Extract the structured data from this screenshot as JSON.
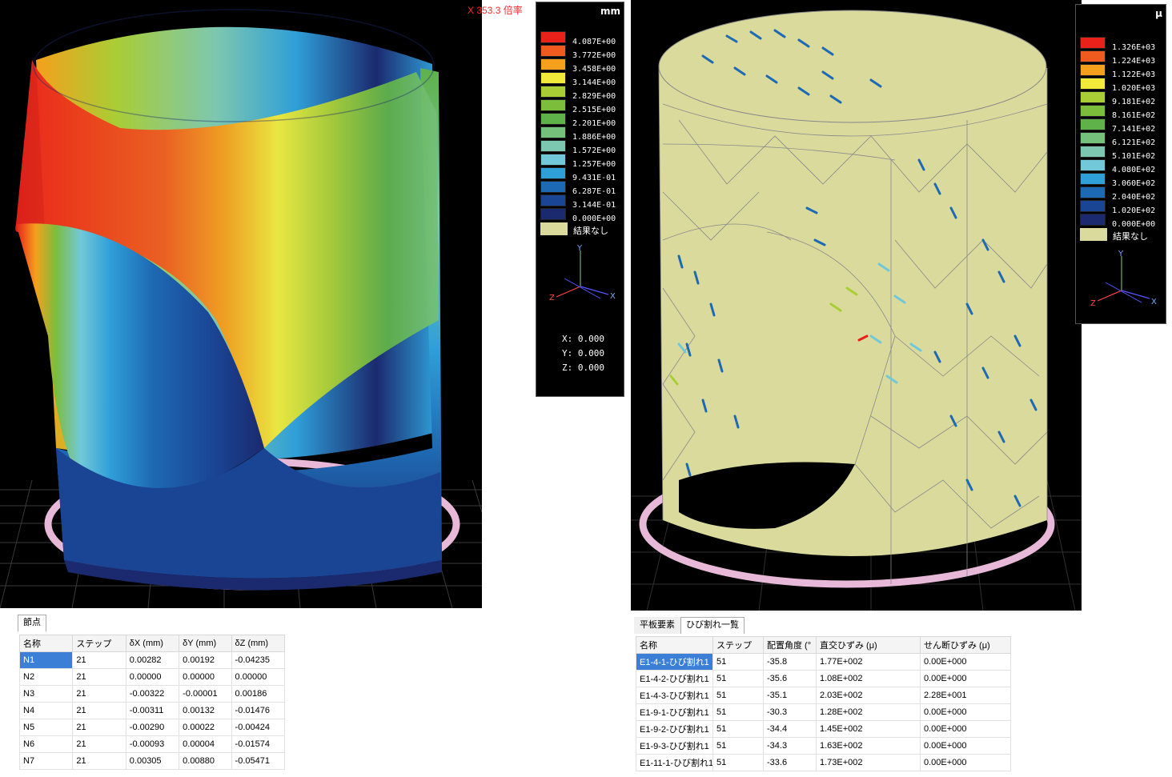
{
  "left_view": {
    "magnification_text": "X 353.3 倍率",
    "legend": {
      "unit": "mm",
      "levels": [
        {
          "value": "4.087E+00",
          "color": "#e8211b"
        },
        {
          "value": "3.772E+00",
          "color": "#ef5a1f"
        },
        {
          "value": "3.458E+00",
          "color": "#f5a01c"
        },
        {
          "value": "3.144E+00",
          "color": "#f2ea3a"
        },
        {
          "value": "2.829E+00",
          "color": "#a9cd35"
        },
        {
          "value": "2.515E+00",
          "color": "#7cbd3c"
        },
        {
          "value": "2.201E+00",
          "color": "#5fb14a"
        },
        {
          "value": "1.886E+00",
          "color": "#75c07a"
        },
        {
          "value": "1.572E+00",
          "color": "#7dc7b0"
        },
        {
          "value": "1.257E+00",
          "color": "#72c8d8"
        },
        {
          "value": "9.431E-01",
          "color": "#2f9fd8"
        },
        {
          "value": "6.287E-01",
          "color": "#1e69b3"
        },
        {
          "value": "3.144E-01",
          "color": "#1a4494"
        },
        {
          "value": "0.000E+00",
          "color": "#1b2a6e"
        }
      ],
      "no_result_label": "結果なし",
      "coords": {
        "x": "X: 0.000",
        "y": "Y: 0.000",
        "z": "Z: 0.000"
      }
    },
    "axis": {
      "x": "X",
      "y": "Y",
      "z": "Z"
    }
  },
  "right_view": {
    "legend": {
      "unit": "μ",
      "levels": [
        {
          "value": "1.326E+03",
          "color": "#e8211b"
        },
        {
          "value": "1.224E+03",
          "color": "#ef5a1f"
        },
        {
          "value": "1.122E+03",
          "color": "#f5a01c"
        },
        {
          "value": "1.020E+03",
          "color": "#f2ea3a"
        },
        {
          "value": "9.181E+02",
          "color": "#a9cd35"
        },
        {
          "value": "8.161E+02",
          "color": "#7cbd3c"
        },
        {
          "value": "7.141E+02",
          "color": "#5fb14a"
        },
        {
          "value": "6.121E+02",
          "color": "#75c07a"
        },
        {
          "value": "5.101E+02",
          "color": "#7dc7b0"
        },
        {
          "value": "4.080E+02",
          "color": "#72c8d8"
        },
        {
          "value": "3.060E+02",
          "color": "#2f9fd8"
        },
        {
          "value": "2.040E+02",
          "color": "#1e69b3"
        },
        {
          "value": "1.020E+02",
          "color": "#1a4494"
        },
        {
          "value": "0.000E+00",
          "color": "#1b2a6e"
        }
      ],
      "no_result_label": "結果なし"
    },
    "axis": {
      "x": "X",
      "y": "Y",
      "z": "Z"
    }
  },
  "nodes_panel": {
    "tab": "節点",
    "columns": [
      "名称",
      "ステップ",
      "δX (mm)",
      "δY (mm)",
      "δZ (mm)"
    ],
    "rows": [
      [
        "N1",
        "21",
        "0.00282",
        "0.00192",
        "-0.04235"
      ],
      [
        "N2",
        "21",
        "0.00000",
        "0.00000",
        "0.00000"
      ],
      [
        "N3",
        "21",
        "-0.00322",
        "-0.00001",
        "0.00186"
      ],
      [
        "N4",
        "21",
        "-0.00311",
        "0.00132",
        "-0.01476"
      ],
      [
        "N5",
        "21",
        "-0.00290",
        "0.00022",
        "-0.00424"
      ],
      [
        "N6",
        "21",
        "-0.00093",
        "0.00004",
        "-0.01574"
      ],
      [
        "N7",
        "21",
        "0.00305",
        "0.00880",
        "-0.05471"
      ]
    ]
  },
  "cracks_panel": {
    "tabs": [
      "平板要素",
      "ひび割れ一覧"
    ],
    "columns": [
      "名称",
      "ステップ",
      "配置角度 (°",
      "直交ひずみ (μ)",
      "せん断ひずみ (μ)"
    ],
    "rows": [
      [
        "E1-4-1-ひび割れ1",
        "51",
        "-35.8",
        "1.77E+002",
        "0.00E+000"
      ],
      [
        "E1-4-2-ひび割れ1",
        "51",
        "-35.6",
        "1.08E+002",
        "0.00E+000"
      ],
      [
        "E1-4-3-ひび割れ1",
        "51",
        "-35.1",
        "2.03E+002",
        "2.28E+001"
      ],
      [
        "E1-9-1-ひび割れ1",
        "51",
        "-30.3",
        "1.28E+002",
        "0.00E+000"
      ],
      [
        "E1-9-2-ひび割れ1",
        "51",
        "-34.4",
        "1.45E+002",
        "0.00E+000"
      ],
      [
        "E1-9-3-ひび割れ1",
        "51",
        "-34.3",
        "1.63E+002",
        "0.00E+000"
      ],
      [
        "E1-11-1-ひび割れ1",
        "51",
        "-33.6",
        "1.73E+002",
        "0.00E+000"
      ]
    ]
  }
}
